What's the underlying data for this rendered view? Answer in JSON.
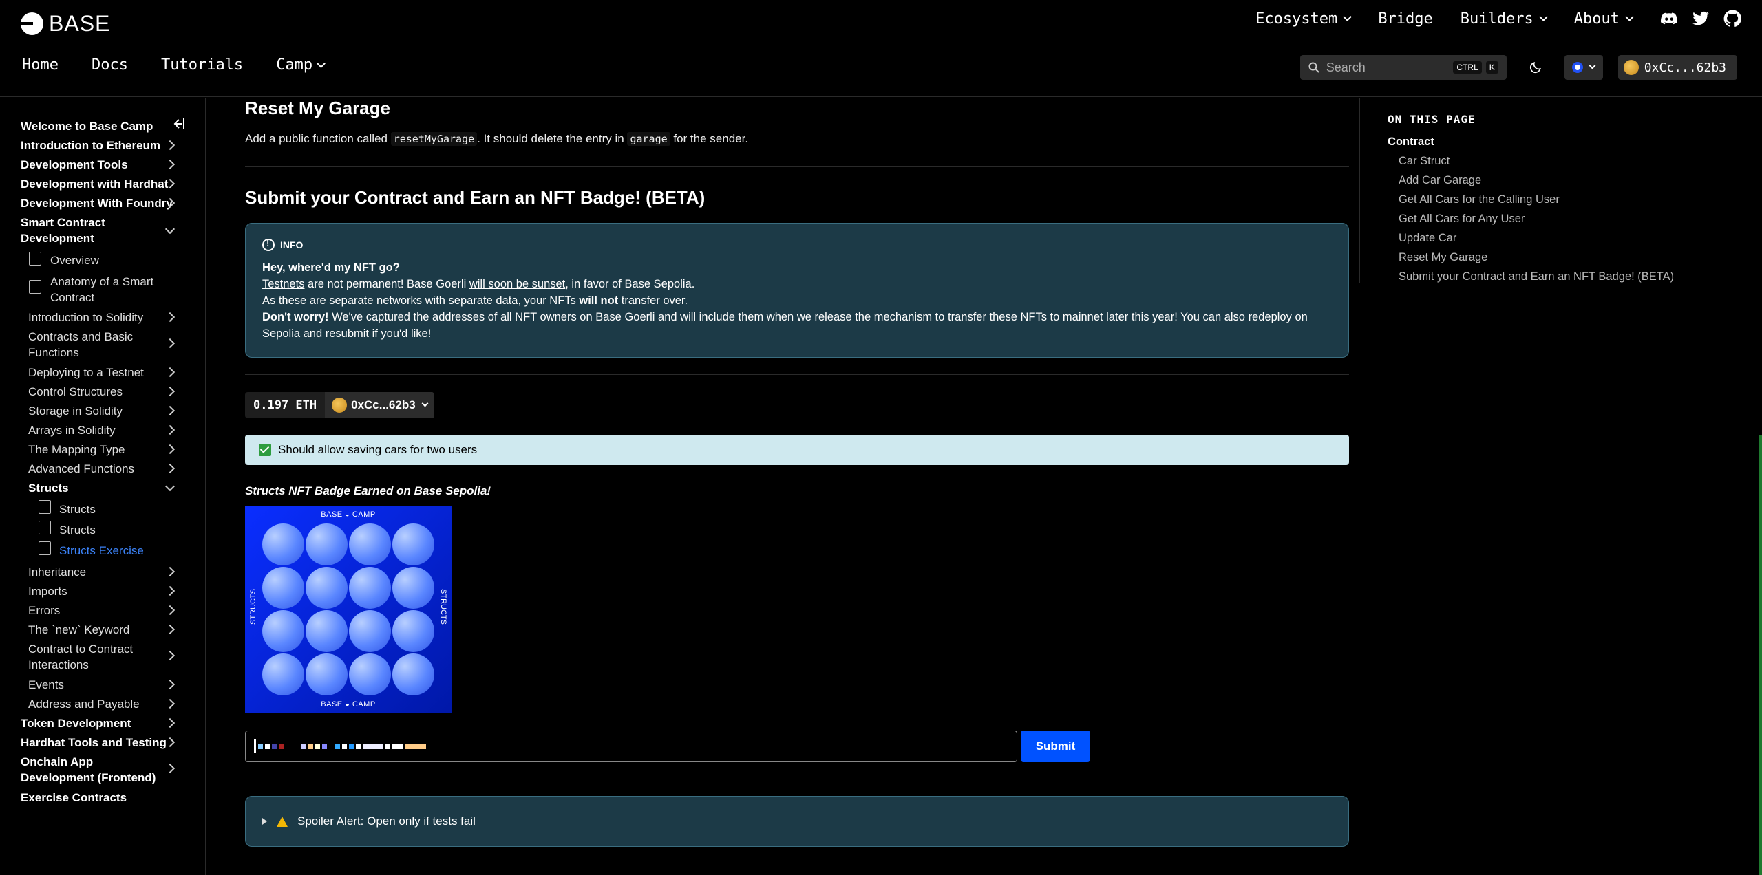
{
  "brand": {
    "name": "BASE"
  },
  "top_nav": [
    "Ecosystem",
    "Bridge",
    "Builders",
    "About"
  ],
  "top_nav_has_dropdown": [
    true,
    false,
    true,
    true
  ],
  "sub_nav": [
    "Home",
    "Docs",
    "Tutorials",
    "Camp"
  ],
  "search": {
    "placeholder": "Search",
    "kbd1": "CTRL",
    "kbd2": "K"
  },
  "account": {
    "short": "0xCc...62b3"
  },
  "sidebar": {
    "items": [
      {
        "label": "Welcome to Base Camp"
      },
      {
        "label": "Introduction to Ethereum"
      },
      {
        "label": "Development Tools"
      },
      {
        "label": "Development with Hardhat"
      },
      {
        "label": "Development With Foundry"
      },
      {
        "label": "Smart Contract Development"
      },
      {
        "label": "Overview"
      },
      {
        "label": "Anatomy of a Smart Contract"
      },
      {
        "label": "Introduction to Solidity"
      },
      {
        "label": "Contracts and Basic Functions"
      },
      {
        "label": "Deploying to a Testnet"
      },
      {
        "label": "Control Structures"
      },
      {
        "label": "Storage in Solidity"
      },
      {
        "label": "Arrays in Solidity"
      },
      {
        "label": "The Mapping Type"
      },
      {
        "label": "Advanced Functions"
      },
      {
        "label": "Structs"
      },
      {
        "label": "Structs"
      },
      {
        "label": "Structs"
      },
      {
        "label": "Structs Exercise"
      },
      {
        "label": "Inheritance"
      },
      {
        "label": "Imports"
      },
      {
        "label": "Errors"
      },
      {
        "label": "The `new` Keyword"
      },
      {
        "label": "Contract to Contract Interactions"
      },
      {
        "label": "Events"
      },
      {
        "label": "Address and Payable"
      },
      {
        "label": "Token Development"
      },
      {
        "label": "Hardhat Tools and Testing"
      },
      {
        "label": "Onchain App Development (Frontend)"
      },
      {
        "label": "Exercise Contracts"
      }
    ]
  },
  "main": {
    "reset_heading": "Reset My Garage",
    "reset_p1": "Add a public function called",
    "reset_code1": "resetMyGarage",
    "reset_p2": ". It should delete the entry in",
    "reset_code2": "garage",
    "reset_p3": "for the sender.",
    "submit_heading": "Submit your Contract and Earn an NFT Badge! (BETA)",
    "info": {
      "label": "INFO",
      "q": "Hey, where'd my NFT go?",
      "l2a": "Testnets",
      "l2b": " are not permanent! Base Goerli ",
      "l2c": "will soon be sunset",
      "l2d": ", in favor of Base Sepolia.",
      "l3a": "As these are separate networks with separate data, your NFTs ",
      "l3b": "will not",
      "l3c": " transfer over.",
      "l4a": "Don't worry!",
      "l4b": " We've captured the addresses of all NFT owners on Base Goerli and will include them when we release the mechanism to transfer these NFTs to mainnet later this year! You can also redeploy on Sepolia and resubmit if you'd like!"
    },
    "wallet": {
      "balance": "0.197 ETH",
      "account": "0xCc...62b3"
    },
    "test_result": "Should allow saving cars for two users",
    "badge_title": "Structs NFT Badge Earned on Base Sepolia!",
    "nft": {
      "top": "BASE ◒ CAMP",
      "bottom": "BASE ◒ CAMP",
      "left": "STRUCTS",
      "right": "STRUCTS"
    },
    "submit_label": "Submit",
    "spoiler": "Spoiler Alert: Open only if tests fail"
  },
  "toc": {
    "title": "ON THIS PAGE",
    "top": "Contract",
    "items": [
      "Car Struct",
      "Add Car Garage",
      "Get All Cars for the Calling User",
      "Get All Cars for Any User",
      "Update Car",
      "Reset My Garage",
      "Submit your Contract and Earn an NFT Badge! (BETA)"
    ]
  },
  "colors": {
    "accent": "#0052ff",
    "info_bg": "#1c3a47",
    "success_bg": "#cfe9ef",
    "active_link": "#3b82f6"
  }
}
